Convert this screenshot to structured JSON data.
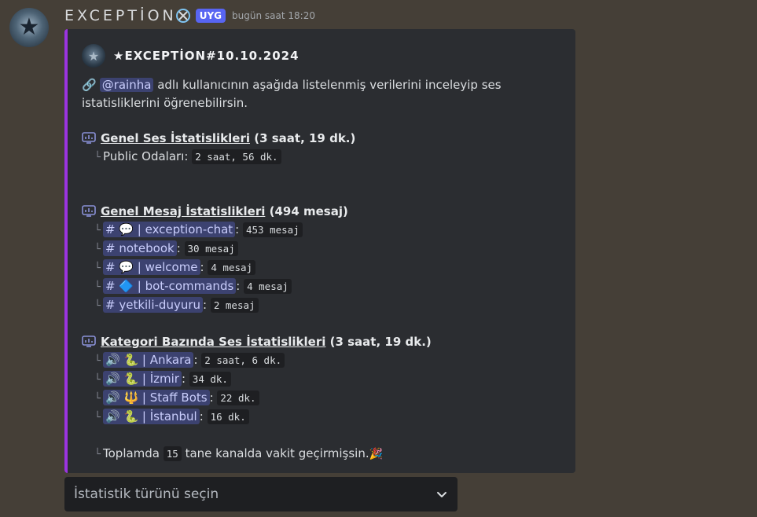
{
  "message": {
    "author": "EXCEPTİON",
    "tag": "UYG",
    "timestamp": "bugün saat 18:20"
  },
  "embed": {
    "accent_color": "#9b34e0",
    "author_name": "★EXCEPTİON#10.10.2024",
    "description": {
      "mention": "@rainha",
      "text": " adlı kullanıcının aşağıda listelenmiş verilerini inceleyip ses istatisliklerini öğrenebilirsin."
    },
    "voice_general": {
      "title": "Genel Ses İstatislikleri",
      "summary": "(3 saat, 19 dk.)",
      "items": [
        {
          "label": "Public Odaları:",
          "value": "2 saat, 56 dk."
        }
      ]
    },
    "message_general": {
      "title": "Genel Mesaj İstatislikleri",
      "summary": "(494 mesaj)",
      "items": [
        {
          "channel": "# 💬 | exception-chat",
          "value": "453 mesaj"
        },
        {
          "channel": "# notebook",
          "value": "30 mesaj"
        },
        {
          "channel": "# 💬 | welcome",
          "value": "4 mesaj"
        },
        {
          "channel": "# 🔷 | bot-commands",
          "value": "4 mesaj"
        },
        {
          "channel": "# yetkili-duyuru",
          "value": "2 mesaj"
        }
      ]
    },
    "voice_category": {
      "title": "Kategori Bazında Ses İstatislikleri",
      "summary": "(3 saat, 19 dk.)",
      "items": [
        {
          "channel": "🔊 🐍 | Ankara",
          "value": "2 saat, 6 dk."
        },
        {
          "channel": "🔊 🐍 | İzmir",
          "value": "34 dk."
        },
        {
          "channel": "🔊 🔱 | Staff Bots",
          "value": "22 dk."
        },
        {
          "channel": "🔊 🐍 | İstanbul",
          "value": "16 dk."
        }
      ]
    },
    "total": {
      "prefix": "Toplamda ",
      "count": "15",
      "suffix": " tane kanalda vakit geçirmişsin.",
      "emoji": "🎉"
    }
  },
  "select_menu": {
    "placeholder": "İstatistik türünü seçin"
  }
}
